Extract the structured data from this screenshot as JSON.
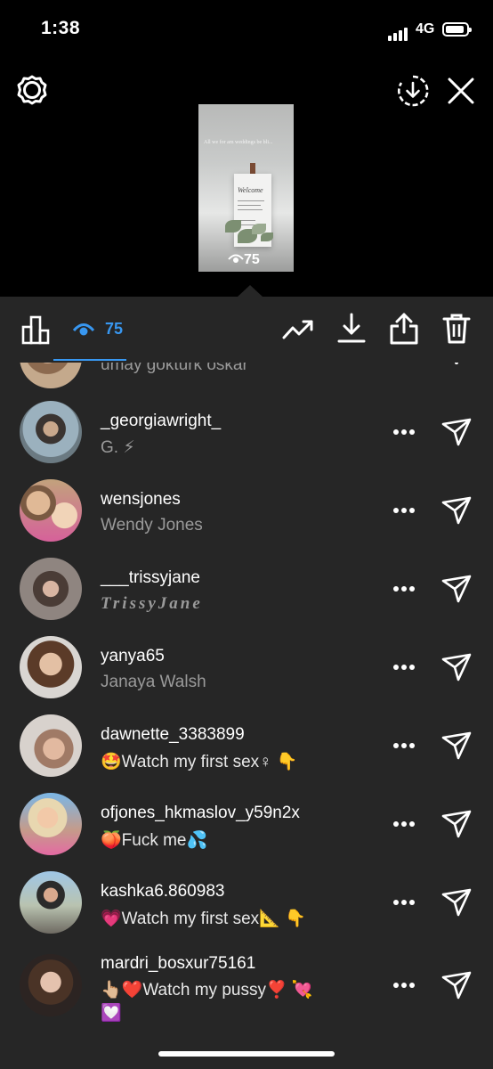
{
  "status": {
    "time": "1:38",
    "network": "4G"
  },
  "story": {
    "views": "75",
    "text_overlay": "All we for am weddings be bli...",
    "card_title": "Welcome"
  },
  "toolbar": {
    "view_count": "75"
  },
  "viewers": [
    {
      "username": "",
      "name": "umay göktürk oskar"
    },
    {
      "username": "_georgiawright_",
      "name": "G. ⚡"
    },
    {
      "username": "wensjones",
      "name": "Wendy Jones"
    },
    {
      "username": "___trissyjane",
      "name": "TrissyJane"
    },
    {
      "username": "yanya65",
      "name": "Janaya Walsh"
    },
    {
      "username": "dawnette_3383899",
      "name": "🤩Watch my first sex♀ 👇"
    },
    {
      "username": "ofjones_hkmaslov_y59n2x",
      "name": "🍑Fuck me💦"
    },
    {
      "username": "kashka6.860983",
      "name": "💗Watch my first sex📐 👇"
    },
    {
      "username": "mardri_bosxur75161",
      "name": "👆🏼❤️Watch my pussy❣️ 💘",
      "name2": "💟"
    }
  ],
  "icons": [
    "gear-icon",
    "download-circle-icon",
    "close-icon",
    "bar-chart-icon",
    "eye-icon",
    "trending-icon",
    "download-icon",
    "share-icon",
    "trash-icon",
    "more-icon",
    "send-icon"
  ],
  "colors": {
    "accent": "#3897f0",
    "panel": "#262626",
    "secondary_text": "#9a9a9a"
  }
}
